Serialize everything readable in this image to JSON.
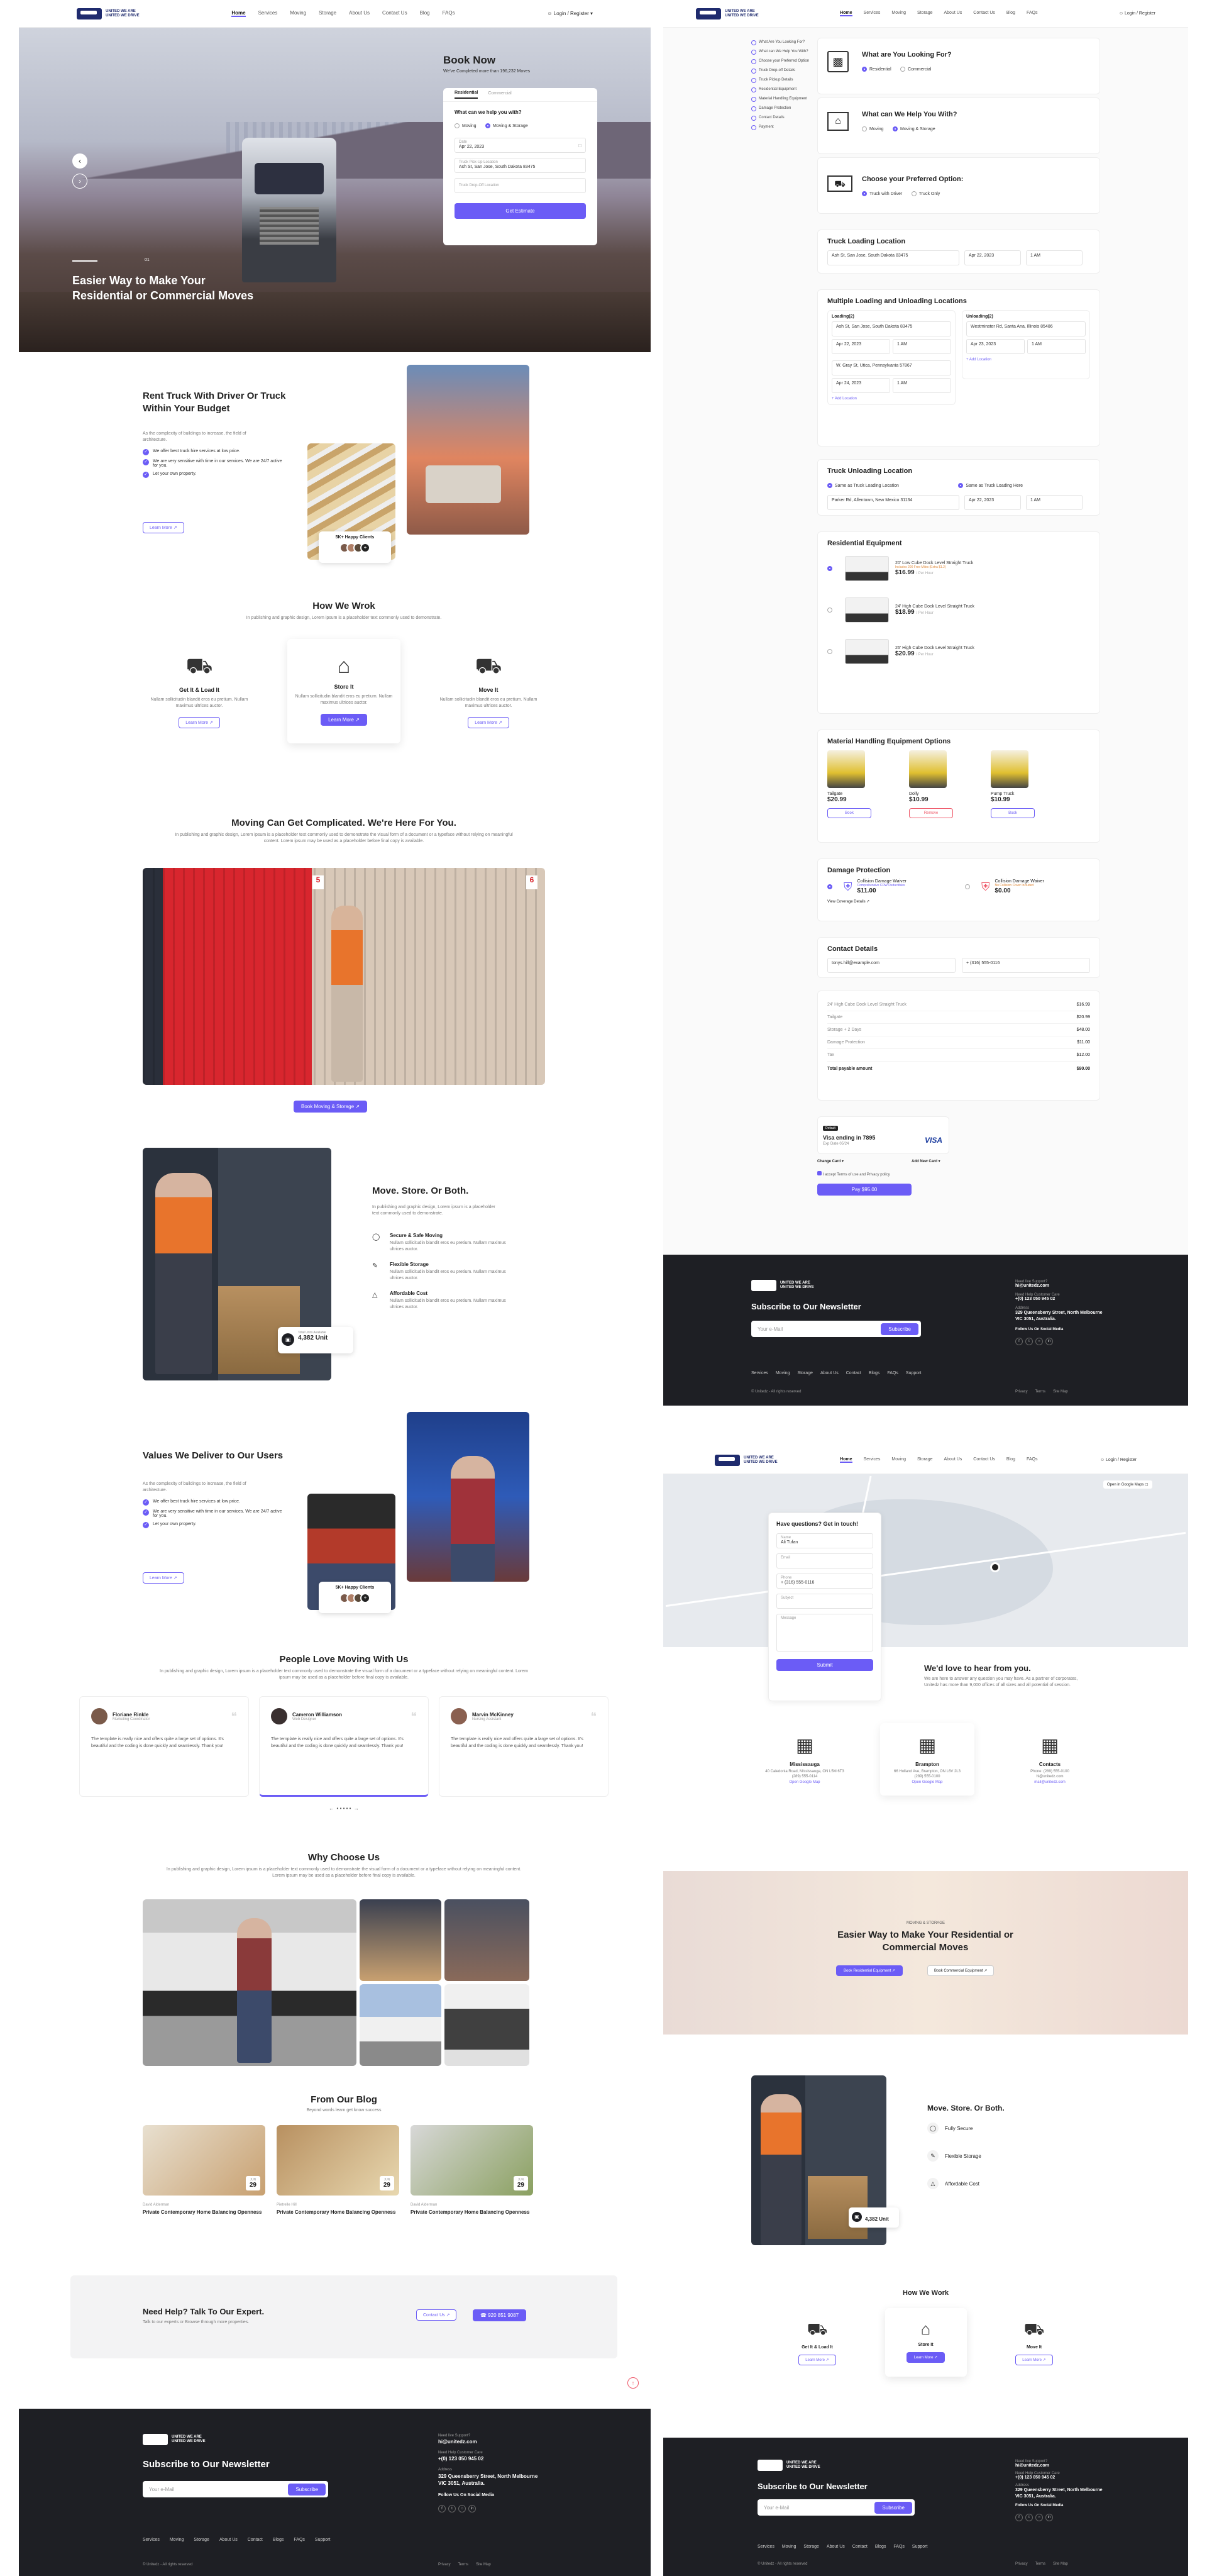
{
  "brand": {
    "line1": "UNITED WE ARE",
    "line2": "UNITED WE DRIVE"
  },
  "nav": {
    "links": [
      "Home",
      "Services",
      "Moving",
      "Storage",
      "About Us",
      "Contact Us",
      "Blog",
      "FAQs"
    ],
    "login": "Login / Register"
  },
  "hero": {
    "title": "Easier Way to Make Your Residential or Commercial Moves",
    "slide_counter": "01"
  },
  "book": {
    "title": "Book Now",
    "subtitle": "We've Completed more than 196,232 Moves",
    "tabs": [
      "Residential",
      "Commercial"
    ],
    "question": "What can we help you with?",
    "options": [
      "Moving",
      "Moving & Storage"
    ],
    "date_label": "Date",
    "date_value": "Apr 22, 2023",
    "pickup_label": "Truck Pick-Up Location",
    "pickup_value": "Ash St, San Jose, South Dakota 83475",
    "dropoff_placeholder": "Truck Drop-Off Location",
    "cta": "Get Estimate"
  },
  "rent": {
    "title": "Rent Truck With Driver Or Truck Within Your Budget",
    "text": "As the complexity of buildings to increase, the field of architecture.",
    "checks": [
      "We offer best truck hire services at low price.",
      "We are very sensitive with time in our services. We are 24/7 active for you.",
      "Let your own property."
    ],
    "cta": "Learn More",
    "clients": "5K+ Happy Clients"
  },
  "how": {
    "title": "How We Wrok",
    "text": "In publishing and graphic design, Lorem ipsum is a placeholder text commonly used to demonstrate.",
    "steps": [
      {
        "title": "Get It & Load It",
        "text": "Nullam sollicitudin blandit eros eu pretium. Nullam maximus ultrices auctor.",
        "cta": "Learn More"
      },
      {
        "title": "Store It",
        "text": "Nullam sollicitudin blandit eros eu pretium. Nullam maximus ultrices auctor.",
        "cta": "Learn More"
      },
      {
        "title": "Move It",
        "text": "Nullam sollicitudin blandit eros eu pretium. Nullam maximus ultrices auctor.",
        "cta": "Learn More"
      }
    ]
  },
  "complicated": {
    "title": "Moving Can Get Complicated. We're Here For You.",
    "text": "In publishing and graphic design, Lorem ipsum is a placeholder text commonly used to demonstrate the visual form of a document or a typeface without relying on meaningful content. Lorem ipsum may be used as a placeholder before final copy is available.",
    "cta": "Book Moving & Storage",
    "container_numbers": [
      "5",
      "6"
    ]
  },
  "mso": {
    "title": "Move. Store. Or Both.",
    "text": "In publishing and graphic design, Lorem ipsum is a placeholder text commonly used to demonstrate.",
    "features": [
      {
        "title": "Secure & Safe Moving",
        "text": "Nullam sollicitudin blandit eros eu pretium. Nullam maximus ultrices auctor."
      },
      {
        "title": "Flexible Storage",
        "text": "Nullam sollicitudin blandit eros eu pretium. Nullam maximus ultrices auctor."
      },
      {
        "title": "Affordable Cost",
        "text": "Nullam sollicitudin blandit eros eu pretium. Nullam maximus ultrices auctor."
      }
    ],
    "units_label": "Total Units Available",
    "units": "4,382 Unit"
  },
  "values": {
    "title": "Values We Deliver to Our Users",
    "text": "As the complexity of buildings to increase, the field of architecture.",
    "checks": [
      "We offer best truck hire services at low price.",
      "We are very sensitive with time in our services. We are 24/7 active for you.",
      "Let your own property."
    ],
    "cta": "Learn More",
    "clients": "5K+ Happy Clients"
  },
  "testimonials": {
    "title": "People Love Moving With Us",
    "text": "In publishing and graphic design, Lorem ipsum is a placeholder text commonly used to demonstrate the visual form of a document or a typeface without relying on meaningful content. Lorem ipsum may be used as a placeholder before final copy is available.",
    "items": [
      {
        "name": "Floriane Rinkle",
        "role": "Marketing Coordinator",
        "text": "The template is really nice and offers quite a large set of options. It's beautiful and the coding is done quickly and seamlessly. Thank you!"
      },
      {
        "name": "Cameron Williamson",
        "role": "Web Designer",
        "text": "The template is really nice and offers quite a large set of options. It's beautiful and the coding is done quickly and seamlessly. Thank you!"
      },
      {
        "name": "Marvin McKinney",
        "role": "Nursing Assistant",
        "text": "The template is really nice and offers quite a large set of options. It's beautiful and the coding is done quickly and seamlessly. Thank you!"
      }
    ]
  },
  "why": {
    "title": "Why Choose Us",
    "text": "In publishing and graphic design, Lorem ipsum is a placeholder text commonly used to demonstrate the visual form of a document or a typeface without relying on meaningful content. Lorem ipsum may be used as a placeholder before final copy is available."
  },
  "blog": {
    "title": "From Our Blog",
    "text": "Beyond words learn get know success",
    "posts": [
      {
        "month": "JUN",
        "day": "29",
        "author": "David Alderman",
        "title": "Private Contemporary Home Balancing Openness"
      },
      {
        "month": "JUN",
        "day": "29",
        "author": "Pietrelle Hill",
        "title": "Private Contemporary Home Balancing Openness"
      },
      {
        "month": "JUN",
        "day": "29",
        "author": "David Alderman",
        "title": "Private Contemporary Home Balancing Openness"
      }
    ]
  },
  "help": {
    "title": "Need Help? Talk To Our Expert.",
    "text": "Talk to our experts or Browse through more properties.",
    "contact_cta": "Contact Us",
    "phone_cta": "920 851 9087"
  },
  "footer": {
    "newsletter": "Subscribe to Our Newsletter",
    "email_placeholder": "Your e-Mail",
    "subscribe": "Subscribe",
    "links": [
      "Services",
      "Moving",
      "Storage",
      "About Us",
      "Contact",
      "Blogs",
      "FAQs",
      "Support"
    ],
    "copyright": "© Unitedz - All rights reserved",
    "need_support": "Need live Support?",
    "email": "hi@unitedz.com",
    "support_label": "Need Help Customer Care",
    "phone": "+(0) 123 050 945 02",
    "address_label": "Address",
    "address": "329 Queensberry Street, North Melbourne VIC 3051, Australia.",
    "social": "Follow Us On Social Media",
    "legal": [
      "Privacy",
      "Terms",
      "Site Map"
    ]
  },
  "booking": {
    "steps": [
      "What Are You Looking For?",
      "What can We Help You With?",
      "Choose your Preferred Option",
      "Truck Drop-off Details",
      "Truck Pickup Details",
      "Residential Equipment",
      "Material Handling Equipment",
      "Damage Protection",
      "Contact Details",
      "Payment"
    ],
    "looking_title": "What are You Looking For?",
    "looking_options": [
      "Residential",
      "Commercial"
    ],
    "help_title": "What can We Help You With?",
    "help_options": [
      "Moving",
      "Moving & Storage"
    ],
    "option_title": "Choose your Preferred Option:",
    "option_options": [
      "Truck with Driver",
      "Truck Only"
    ],
    "loading_title": "Truck Loading Location",
    "loading_addr": "Ash St, San Jose, South Dakota 83475",
    "loading_date": "Apr 22, 2023",
    "loading_time": "1 AM",
    "multi_title": "Multiple Loading and Unloading Locations",
    "loading_label": "Loading(2)",
    "unloading_label": "Unloading(2)",
    "multi_addr1": "Ash St, San Jose, South Dakota 83475",
    "multi_addr2": "Westminster Rd, Santa Ana, Illinois 85486",
    "multi_addr3": "W. Gray St, Utica, Pennsylvania 57867",
    "multi_date1": "Apr 22, 2023",
    "multi_date2": "Apr 23, 2023",
    "multi_date3": "Apr 24, 2023",
    "add_location": "+ Add Location",
    "unload_title": "Truck Unloading Location",
    "unload_opt1": "Same as Truck Loading Location",
    "unload_opt2": "Same as Truck Loading Here",
    "unload_addr": "Parker Rd, Allentown, New Mexico 31134",
    "unload_date": "Apr 22, 2023",
    "res_title": "Residential Equipment",
    "trucks": [
      {
        "name": "20' Low Cube Dock Level Straight Truck",
        "sub": "Includes 200 Free Miles (Extra $1.2)",
        "price": "$16.99",
        "per": "/ Per Hour"
      },
      {
        "name": "24' High Cube Dock Level Straight Truck",
        "sub": "",
        "price": "$18.99",
        "per": "/ Per Hour"
      },
      {
        "name": "26' High Cube Dock Level Straight Truck",
        "sub": "",
        "price": "$20.99",
        "per": "/ Per Hour"
      }
    ],
    "mat_title": "Material Handling Equipment Options",
    "mats": [
      {
        "name": "Tailgate",
        "price": "$20.99",
        "cta": "Book"
      },
      {
        "name": "Dolly",
        "price": "$10.99",
        "cta": "Remove"
      },
      {
        "name": "Pump Truck",
        "price": "$10.99",
        "cta": "Book"
      }
    ],
    "damage_title": "Damage Protection",
    "damage": [
      {
        "name": "Collision Damage Waiver",
        "sub": "Comprehensive CDW Deductibles",
        "price": "$11.00"
      },
      {
        "name": "Collision Damage Waiver",
        "sub": "No Collision Cover Included",
        "price": "$0.00"
      }
    ],
    "coverage": "View Coverage Details",
    "contact_title": "Contact Details",
    "contact_email": "tonys.hill@example.com",
    "contact_phone": "+ (316) 555-0116",
    "summary": [
      {
        "label": "24' High Cube Dock Level Straight Truck",
        "value": "$16.99"
      },
      {
        "label": "Tailgate",
        "value": "$20.99"
      },
      {
        "label": "Storage + 2 Days",
        "value": "$48.00"
      },
      {
        "label": "Damage Protection",
        "value": "$11.00"
      },
      {
        "label": "Tax",
        "value": "$12.00"
      }
    ],
    "total_label": "Total payable amount",
    "total": "$90.00",
    "card_tag": "Default",
    "card_title": "Visa ending in 7895",
    "card_exp": "Exp Date 05/24",
    "card_brand": "VISA",
    "change_card": "Change Card",
    "add_card": "Add New Card",
    "terms": "I accept Terms of use and Privacy policy",
    "pay": "Pay $95.00"
  },
  "contact": {
    "map_btn": "Open in Google Maps",
    "form_title": "Have questions? Get in touch!",
    "name_label": "Name",
    "name_value": "Ali Tufan",
    "email_label": "Email",
    "phone_label": "Phone",
    "phone_value": "+ (316) 555-0116",
    "subject_label": "Subject",
    "message_label": "Message",
    "submit": "Submit",
    "hear_title": "We'd love to hear from you.",
    "hear_text": "We are here to answer any question you may have. As a partner of corporates, Unitedz has more than 9,000 offices of all sizes and all potential of session.",
    "offices": [
      {
        "name": "Mississauga",
        "addr": "40 Caledonia Road, Mississauga, ON L5M 6T3",
        "phone": "(289) 555-0114",
        "link": "Open Google Map"
      },
      {
        "name": "Brampton",
        "addr": "66 Holland Ave, Brampton, ON L6V 2L3",
        "phone": "(289) 555-0100",
        "link": "Open Google Map"
      },
      {
        "name": "Contacts",
        "addr": "Phone: (289) 555-0100",
        "phone": "hi@unitedz.com",
        "link": "mail@unitedz.com"
      }
    ],
    "banner_kicker": "MOVING & STORAGE",
    "banner_title": "Easier Way to Make Your Residential or Commercial Moves",
    "banner_cta1": "Book Residential Equipment",
    "banner_cta2": "Book Commercial Equipment",
    "mso_title": "Move. Store. Or Both.",
    "mso_items": [
      "Fully Secure",
      "Flexible Storage",
      "Affordable Cost"
    ],
    "units": "4,382 Unit",
    "how_title": "How We Work",
    "how_steps": [
      "Get It & Load It",
      "Store It",
      "Move It"
    ],
    "how_cta": "Learn More"
  },
  "colors": {
    "accent": "#6b5cf6",
    "dark": "#1e1f24",
    "navy": "#1f2b6e"
  }
}
